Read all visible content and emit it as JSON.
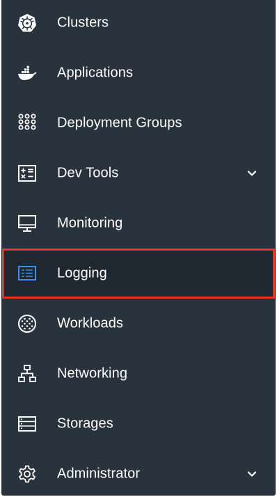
{
  "colors": {
    "sidebar_bg": "#29333d",
    "active_bg": "#1f2731",
    "highlight_border": "#e8331f",
    "active_icon": "#3d8ee8",
    "text": "#ffffff"
  },
  "sidebar": {
    "items": [
      {
        "label": "Clusters",
        "icon": "kubernetes-helm-icon",
        "expandable": false,
        "active": false
      },
      {
        "label": "Applications",
        "icon": "docker-whale-icon",
        "expandable": false,
        "active": false
      },
      {
        "label": "Deployment Groups",
        "icon": "dot-grid-icon",
        "expandable": false,
        "active": false
      },
      {
        "label": "Dev Tools",
        "icon": "calculator-icon",
        "expandable": true,
        "active": false
      },
      {
        "label": "Monitoring",
        "icon": "monitor-icon",
        "expandable": false,
        "active": false
      },
      {
        "label": "Logging",
        "icon": "log-list-icon",
        "expandable": false,
        "active": true
      },
      {
        "label": "Workloads",
        "icon": "workloads-globe-icon",
        "expandable": false,
        "active": false
      },
      {
        "label": "Networking",
        "icon": "network-tree-icon",
        "expandable": false,
        "active": false
      },
      {
        "label": "Storages",
        "icon": "storage-drawers-icon",
        "expandable": false,
        "active": false
      },
      {
        "label": "Administrator",
        "icon": "gear-icon",
        "expandable": true,
        "active": false
      }
    ]
  }
}
